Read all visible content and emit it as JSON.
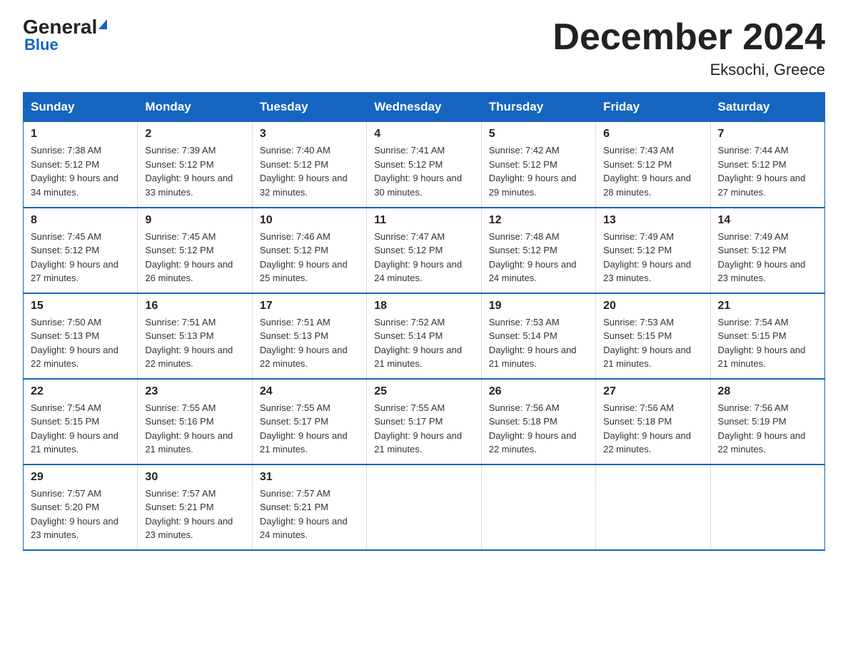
{
  "header": {
    "logo_general": "General",
    "logo_blue": "Blue",
    "title": "December 2024",
    "subtitle": "Eksochi, Greece"
  },
  "days_of_week": [
    "Sunday",
    "Monday",
    "Tuesday",
    "Wednesday",
    "Thursday",
    "Friday",
    "Saturday"
  ],
  "weeks": [
    [
      {
        "day": "1",
        "sunrise": "7:38 AM",
        "sunset": "5:12 PM",
        "daylight": "9 hours and 34 minutes."
      },
      {
        "day": "2",
        "sunrise": "7:39 AM",
        "sunset": "5:12 PM",
        "daylight": "9 hours and 33 minutes."
      },
      {
        "day": "3",
        "sunrise": "7:40 AM",
        "sunset": "5:12 PM",
        "daylight": "9 hours and 32 minutes."
      },
      {
        "day": "4",
        "sunrise": "7:41 AM",
        "sunset": "5:12 PM",
        "daylight": "9 hours and 30 minutes."
      },
      {
        "day": "5",
        "sunrise": "7:42 AM",
        "sunset": "5:12 PM",
        "daylight": "9 hours and 29 minutes."
      },
      {
        "day": "6",
        "sunrise": "7:43 AM",
        "sunset": "5:12 PM",
        "daylight": "9 hours and 28 minutes."
      },
      {
        "day": "7",
        "sunrise": "7:44 AM",
        "sunset": "5:12 PM",
        "daylight": "9 hours and 27 minutes."
      }
    ],
    [
      {
        "day": "8",
        "sunrise": "7:45 AM",
        "sunset": "5:12 PM",
        "daylight": "9 hours and 27 minutes."
      },
      {
        "day": "9",
        "sunrise": "7:45 AM",
        "sunset": "5:12 PM",
        "daylight": "9 hours and 26 minutes."
      },
      {
        "day": "10",
        "sunrise": "7:46 AM",
        "sunset": "5:12 PM",
        "daylight": "9 hours and 25 minutes."
      },
      {
        "day": "11",
        "sunrise": "7:47 AM",
        "sunset": "5:12 PM",
        "daylight": "9 hours and 24 minutes."
      },
      {
        "day": "12",
        "sunrise": "7:48 AM",
        "sunset": "5:12 PM",
        "daylight": "9 hours and 24 minutes."
      },
      {
        "day": "13",
        "sunrise": "7:49 AM",
        "sunset": "5:12 PM",
        "daylight": "9 hours and 23 minutes."
      },
      {
        "day": "14",
        "sunrise": "7:49 AM",
        "sunset": "5:12 PM",
        "daylight": "9 hours and 23 minutes."
      }
    ],
    [
      {
        "day": "15",
        "sunrise": "7:50 AM",
        "sunset": "5:13 PM",
        "daylight": "9 hours and 22 minutes."
      },
      {
        "day": "16",
        "sunrise": "7:51 AM",
        "sunset": "5:13 PM",
        "daylight": "9 hours and 22 minutes."
      },
      {
        "day": "17",
        "sunrise": "7:51 AM",
        "sunset": "5:13 PM",
        "daylight": "9 hours and 22 minutes."
      },
      {
        "day": "18",
        "sunrise": "7:52 AM",
        "sunset": "5:14 PM",
        "daylight": "9 hours and 21 minutes."
      },
      {
        "day": "19",
        "sunrise": "7:53 AM",
        "sunset": "5:14 PM",
        "daylight": "9 hours and 21 minutes."
      },
      {
        "day": "20",
        "sunrise": "7:53 AM",
        "sunset": "5:15 PM",
        "daylight": "9 hours and 21 minutes."
      },
      {
        "day": "21",
        "sunrise": "7:54 AM",
        "sunset": "5:15 PM",
        "daylight": "9 hours and 21 minutes."
      }
    ],
    [
      {
        "day": "22",
        "sunrise": "7:54 AM",
        "sunset": "5:15 PM",
        "daylight": "9 hours and 21 minutes."
      },
      {
        "day": "23",
        "sunrise": "7:55 AM",
        "sunset": "5:16 PM",
        "daylight": "9 hours and 21 minutes."
      },
      {
        "day": "24",
        "sunrise": "7:55 AM",
        "sunset": "5:17 PM",
        "daylight": "9 hours and 21 minutes."
      },
      {
        "day": "25",
        "sunrise": "7:55 AM",
        "sunset": "5:17 PM",
        "daylight": "9 hours and 21 minutes."
      },
      {
        "day": "26",
        "sunrise": "7:56 AM",
        "sunset": "5:18 PM",
        "daylight": "9 hours and 22 minutes."
      },
      {
        "day": "27",
        "sunrise": "7:56 AM",
        "sunset": "5:18 PM",
        "daylight": "9 hours and 22 minutes."
      },
      {
        "day": "28",
        "sunrise": "7:56 AM",
        "sunset": "5:19 PM",
        "daylight": "9 hours and 22 minutes."
      }
    ],
    [
      {
        "day": "29",
        "sunrise": "7:57 AM",
        "sunset": "5:20 PM",
        "daylight": "9 hours and 23 minutes."
      },
      {
        "day": "30",
        "sunrise": "7:57 AM",
        "sunset": "5:21 PM",
        "daylight": "9 hours and 23 minutes."
      },
      {
        "day": "31",
        "sunrise": "7:57 AM",
        "sunset": "5:21 PM",
        "daylight": "9 hours and 24 minutes."
      },
      null,
      null,
      null,
      null
    ]
  ]
}
